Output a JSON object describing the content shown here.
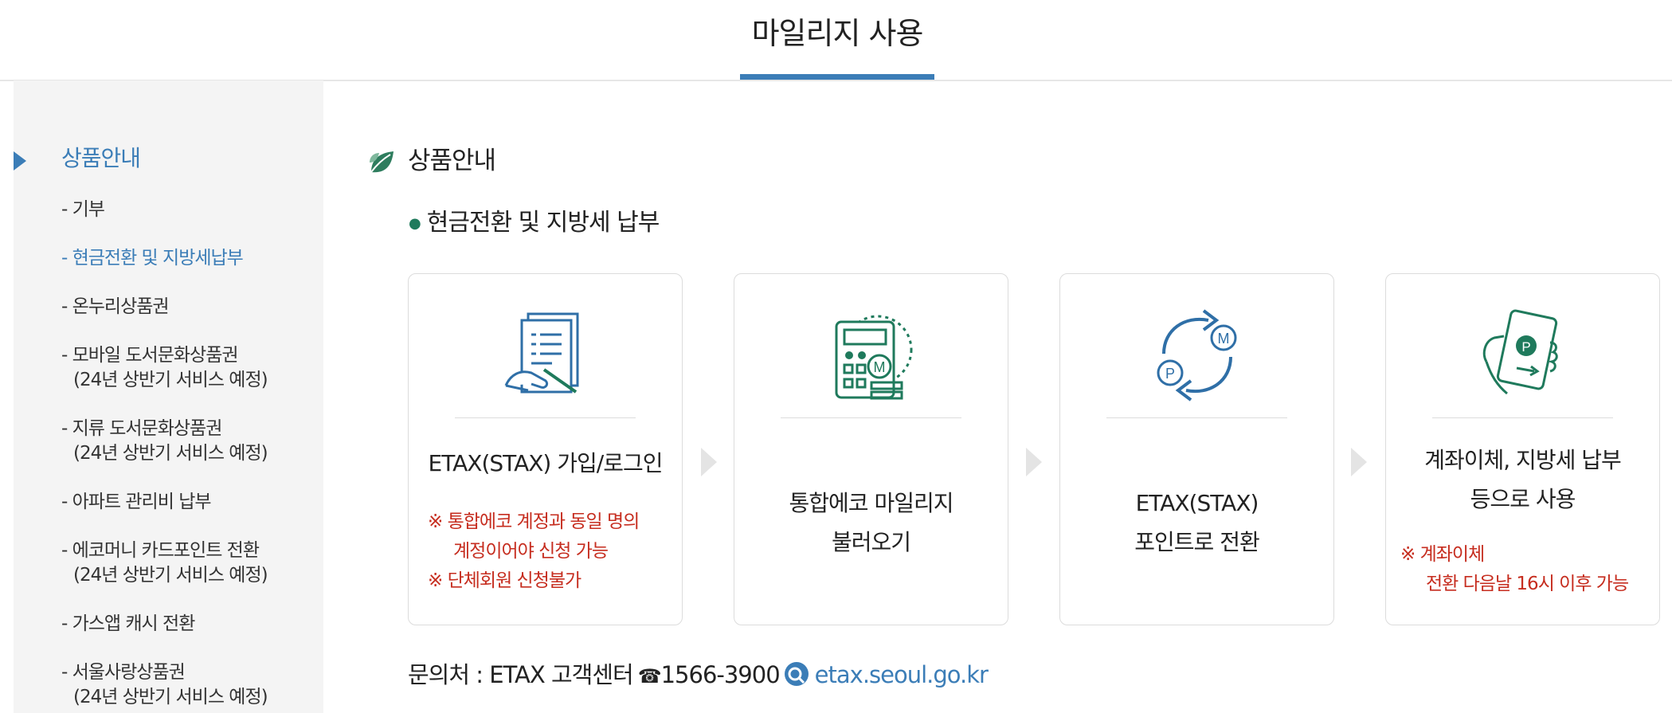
{
  "header": {
    "title": "마일리지 사용"
  },
  "sidebar": {
    "heading": "상품안내",
    "items": [
      {
        "label": "- 기부"
      },
      {
        "label": "- 현금전환 및 지방세납부"
      },
      {
        "label": "- 온누리상품권"
      },
      {
        "label": "- 모바일 도서문화상품권",
        "sub": "(24년 상반기 서비스 예정)"
      },
      {
        "label": "- 지류 도서문화상품권",
        "sub": "(24년 상반기 서비스 예정)"
      },
      {
        "label": "- 아파트 관리비 납부"
      },
      {
        "label": "- 에코머니 카드포인트 전환",
        "sub": "(24년 상반기 서비스 예정)"
      },
      {
        "label": "- 가스앱 캐시 전환"
      },
      {
        "label": "- 서울사랑상품권",
        "sub": "(24년 상반기 서비스 예정)"
      }
    ]
  },
  "content": {
    "section_title": "상품안내",
    "sub_title": "현금전환 및 지방세 납부",
    "steps": [
      {
        "icon": "document-sign-icon",
        "title": "ETAX(STAX) 가입/로그인",
        "notes": [
          "※ 통합에코 계정과 동일 명의",
          "계정이어야 신청 가능",
          "※ 단체회원 신청불가"
        ]
      },
      {
        "icon": "calculator-mileage-icon",
        "title_lines": [
          "통합에코 마일리지",
          "불러오기"
        ]
      },
      {
        "icon": "exchange-points-icon",
        "title_lines": [
          "ETAX(STAX)",
          "포인트로 전환"
        ]
      },
      {
        "icon": "hand-card-icon",
        "title_lines": [
          "계좌이체, 지방세 납부",
          "등으로 사용"
        ],
        "notes": [
          "※ 계좌이체",
          "전환 다음날 16시 이후 가능"
        ]
      }
    ],
    "contact": {
      "label": "문의처 : ETAX 고객센터",
      "phone": "1566-3900",
      "link": "etax.seoul.go.kr"
    }
  },
  "colors": {
    "accent": "#3b7db7",
    "green": "#1f7a5c",
    "note_red": "#c62d1f"
  }
}
